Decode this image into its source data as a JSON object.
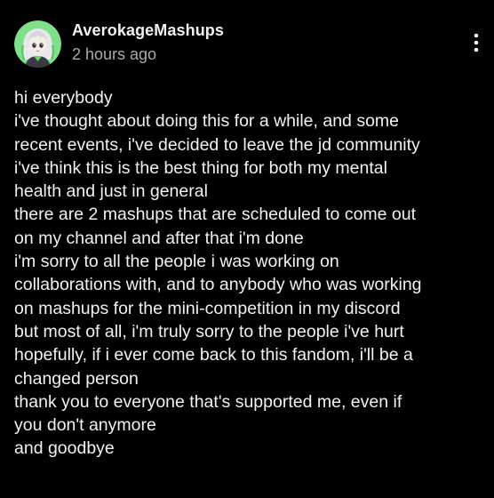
{
  "post": {
    "author": "AverokageMashups",
    "timestamp": "2 hours ago",
    "menu_icon": "more-vertical-icon",
    "avatar_icon": "avatar-anime-girl-green",
    "lines": [
      "hi everybody",
      "i've thought about doing this for a while, and some",
      "recent events, i've decided to leave the jd community",
      "i've think this is the best thing for both my mental",
      "health and just in general",
      "there are 2 mashups that are scheduled to come out",
      "on my channel and after that i'm done",
      "i'm sorry to all the people i was working on",
      "collaborations with, and to anybody who was working",
      "on mashups for the mini-competition in my discord",
      "but most of all, i'm truly sorry to the people i've hurt",
      "hopefully, if i ever come back to this fandom, i'll be a",
      "changed person",
      "thank you to everyone that's supported me, even if",
      "you don't anymore",
      "and goodbye"
    ]
  },
  "colors": {
    "background": "#000000",
    "text": "#f1f1f1",
    "secondary_text": "#aaaaaa",
    "avatar_bg": "#7fe08a"
  }
}
